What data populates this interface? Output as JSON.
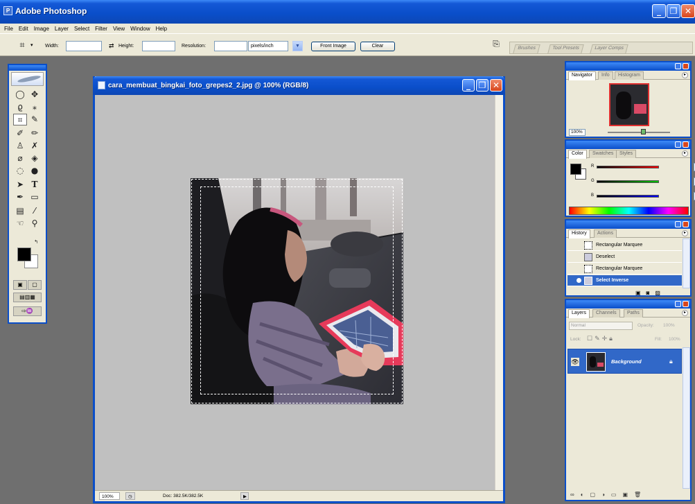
{
  "app": {
    "title": "Adobe Photoshop"
  },
  "menu": [
    "File",
    "Edit",
    "Image",
    "Layer",
    "Select",
    "Filter",
    "View",
    "Window",
    "Help"
  ],
  "options_bar": {
    "width_label": "Width:",
    "height_label": "Height:",
    "resolution_label": "Resolution:",
    "units_value": "pixels/inch",
    "front_image_label": "Front Image",
    "clear_label": "Clear",
    "well_tabs": [
      "Brushes",
      "Tool Presets",
      "Layer Comps"
    ]
  },
  "document": {
    "title": "cara_membuat_bingkai_foto_grepes2_2.jpg @ 100% (RGB/8)",
    "status_zoom": "100%",
    "status_doc": "Doc: 382.5K/382.5K"
  },
  "navigator": {
    "tabs": [
      "Navigator",
      "Info",
      "Histogram"
    ],
    "zoom": "100%"
  },
  "color_panel": {
    "tabs": [
      "Color",
      "Swatches",
      "Styles"
    ],
    "channels": [
      {
        "label": "R",
        "value": "0"
      },
      {
        "label": "G",
        "value": "0"
      },
      {
        "label": "B",
        "value": "0"
      }
    ]
  },
  "history_panel": {
    "tabs": [
      "History",
      "Actions"
    ],
    "items": [
      "Rectangular Marquee",
      "Deselect",
      "Rectangular Marquee",
      "Select Inverse"
    ],
    "active_index": 3
  },
  "layers_panel": {
    "tabs": [
      "Layers",
      "Channels",
      "Paths"
    ],
    "blend_mode": "Normal",
    "opacity_label": "Opacity:",
    "opacity_value": "100%",
    "lock_label": "Lock:",
    "fill_label": "Fill:",
    "fill_value": "100%",
    "layers": [
      {
        "name": "Background"
      }
    ]
  }
}
